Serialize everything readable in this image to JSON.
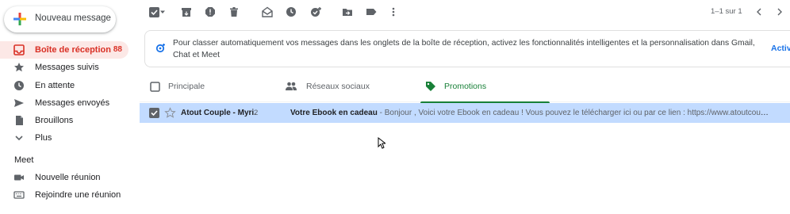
{
  "compose": {
    "label": "Nouveau message",
    "icon": "plus-multicolor-icon"
  },
  "sidebar": {
    "items": [
      {
        "label": "Boîte de réception",
        "count": "88",
        "icon": "inbox-icon",
        "active": true
      },
      {
        "label": "Messages suivis",
        "icon": "star-icon"
      },
      {
        "label": "En attente",
        "icon": "clock-icon"
      },
      {
        "label": "Messages envoyés",
        "icon": "send-icon"
      },
      {
        "label": "Brouillons",
        "icon": "draft-icon"
      },
      {
        "label": "Plus",
        "icon": "chevron-down-icon"
      }
    ],
    "meet_title": "Meet",
    "meet_items": [
      {
        "label": "Nouvelle réunion",
        "icon": "video-icon"
      },
      {
        "label": "Rejoindre une réunion",
        "icon": "keyboard-icon"
      }
    ]
  },
  "toolbar": {
    "pager": "1–1 sur 1"
  },
  "banner": {
    "text": "Pour classer automatiquement vos messages dans les onglets de la boîte de réception, activez les fonctionnalités intelligentes et la personnalisation dans Gmail, Chat et Meet",
    "action": "Activ"
  },
  "tabs": [
    {
      "label": "Principale",
      "icon": "inbox-tab-icon"
    },
    {
      "label": "Réseaux sociaux",
      "icon": "people-icon"
    },
    {
      "label": "Promotions",
      "icon": "tag-icon",
      "active": true
    }
  ],
  "email": {
    "sender": "Atout Couple - Myri.",
    "count": "2",
    "subject": "Votre Ebook en cadeau",
    "snippet": " - Bonjour , Voici votre Ebook en cadeau ! Vous pouvez le télécharger ici ou par ce lien : https://www.atoutcoupl..."
  },
  "colors": {
    "active_nav_bg": "#fce8e6",
    "active_nav_text": "#d93025",
    "promotions_green": "#188038",
    "selected_row": "#c2dbff",
    "link_blue": "#1a73e8"
  }
}
